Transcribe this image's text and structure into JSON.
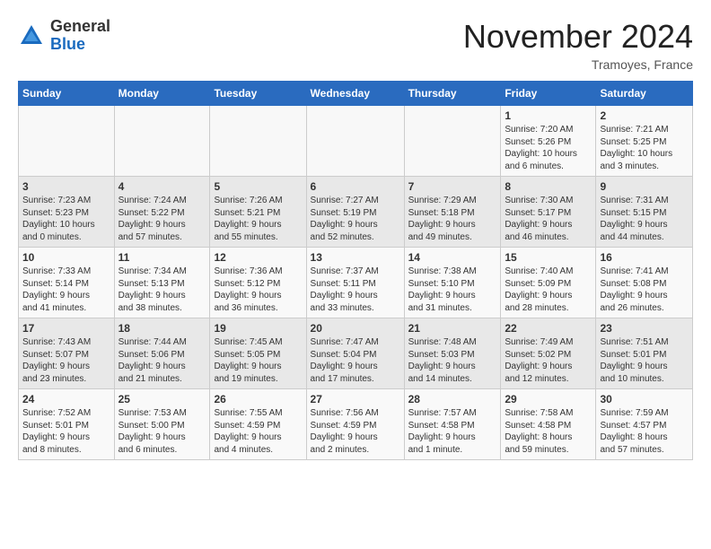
{
  "header": {
    "logo_general": "General",
    "logo_blue": "Blue",
    "month_title": "November 2024",
    "location": "Tramoyes, France"
  },
  "weekdays": [
    "Sunday",
    "Monday",
    "Tuesday",
    "Wednesday",
    "Thursday",
    "Friday",
    "Saturday"
  ],
  "weeks": [
    [
      {
        "day": "",
        "info": ""
      },
      {
        "day": "",
        "info": ""
      },
      {
        "day": "",
        "info": ""
      },
      {
        "day": "",
        "info": ""
      },
      {
        "day": "",
        "info": ""
      },
      {
        "day": "1",
        "info": "Sunrise: 7:20 AM\nSunset: 5:26 PM\nDaylight: 10 hours\nand 6 minutes."
      },
      {
        "day": "2",
        "info": "Sunrise: 7:21 AM\nSunset: 5:25 PM\nDaylight: 10 hours\nand 3 minutes."
      }
    ],
    [
      {
        "day": "3",
        "info": "Sunrise: 7:23 AM\nSunset: 5:23 PM\nDaylight: 10 hours\nand 0 minutes."
      },
      {
        "day": "4",
        "info": "Sunrise: 7:24 AM\nSunset: 5:22 PM\nDaylight: 9 hours\nand 57 minutes."
      },
      {
        "day": "5",
        "info": "Sunrise: 7:26 AM\nSunset: 5:21 PM\nDaylight: 9 hours\nand 55 minutes."
      },
      {
        "day": "6",
        "info": "Sunrise: 7:27 AM\nSunset: 5:19 PM\nDaylight: 9 hours\nand 52 minutes."
      },
      {
        "day": "7",
        "info": "Sunrise: 7:29 AM\nSunset: 5:18 PM\nDaylight: 9 hours\nand 49 minutes."
      },
      {
        "day": "8",
        "info": "Sunrise: 7:30 AM\nSunset: 5:17 PM\nDaylight: 9 hours\nand 46 minutes."
      },
      {
        "day": "9",
        "info": "Sunrise: 7:31 AM\nSunset: 5:15 PM\nDaylight: 9 hours\nand 44 minutes."
      }
    ],
    [
      {
        "day": "10",
        "info": "Sunrise: 7:33 AM\nSunset: 5:14 PM\nDaylight: 9 hours\nand 41 minutes."
      },
      {
        "day": "11",
        "info": "Sunrise: 7:34 AM\nSunset: 5:13 PM\nDaylight: 9 hours\nand 38 minutes."
      },
      {
        "day": "12",
        "info": "Sunrise: 7:36 AM\nSunset: 5:12 PM\nDaylight: 9 hours\nand 36 minutes."
      },
      {
        "day": "13",
        "info": "Sunrise: 7:37 AM\nSunset: 5:11 PM\nDaylight: 9 hours\nand 33 minutes."
      },
      {
        "day": "14",
        "info": "Sunrise: 7:38 AM\nSunset: 5:10 PM\nDaylight: 9 hours\nand 31 minutes."
      },
      {
        "day": "15",
        "info": "Sunrise: 7:40 AM\nSunset: 5:09 PM\nDaylight: 9 hours\nand 28 minutes."
      },
      {
        "day": "16",
        "info": "Sunrise: 7:41 AM\nSunset: 5:08 PM\nDaylight: 9 hours\nand 26 minutes."
      }
    ],
    [
      {
        "day": "17",
        "info": "Sunrise: 7:43 AM\nSunset: 5:07 PM\nDaylight: 9 hours\nand 23 minutes."
      },
      {
        "day": "18",
        "info": "Sunrise: 7:44 AM\nSunset: 5:06 PM\nDaylight: 9 hours\nand 21 minutes."
      },
      {
        "day": "19",
        "info": "Sunrise: 7:45 AM\nSunset: 5:05 PM\nDaylight: 9 hours\nand 19 minutes."
      },
      {
        "day": "20",
        "info": "Sunrise: 7:47 AM\nSunset: 5:04 PM\nDaylight: 9 hours\nand 17 minutes."
      },
      {
        "day": "21",
        "info": "Sunrise: 7:48 AM\nSunset: 5:03 PM\nDaylight: 9 hours\nand 14 minutes."
      },
      {
        "day": "22",
        "info": "Sunrise: 7:49 AM\nSunset: 5:02 PM\nDaylight: 9 hours\nand 12 minutes."
      },
      {
        "day": "23",
        "info": "Sunrise: 7:51 AM\nSunset: 5:01 PM\nDaylight: 9 hours\nand 10 minutes."
      }
    ],
    [
      {
        "day": "24",
        "info": "Sunrise: 7:52 AM\nSunset: 5:01 PM\nDaylight: 9 hours\nand 8 minutes."
      },
      {
        "day": "25",
        "info": "Sunrise: 7:53 AM\nSunset: 5:00 PM\nDaylight: 9 hours\nand 6 minutes."
      },
      {
        "day": "26",
        "info": "Sunrise: 7:55 AM\nSunset: 4:59 PM\nDaylight: 9 hours\nand 4 minutes."
      },
      {
        "day": "27",
        "info": "Sunrise: 7:56 AM\nSunset: 4:59 PM\nDaylight: 9 hours\nand 2 minutes."
      },
      {
        "day": "28",
        "info": "Sunrise: 7:57 AM\nSunset: 4:58 PM\nDaylight: 9 hours\nand 1 minute."
      },
      {
        "day": "29",
        "info": "Sunrise: 7:58 AM\nSunset: 4:58 PM\nDaylight: 8 hours\nand 59 minutes."
      },
      {
        "day": "30",
        "info": "Sunrise: 7:59 AM\nSunset: 4:57 PM\nDaylight: 8 hours\nand 57 minutes."
      }
    ]
  ]
}
